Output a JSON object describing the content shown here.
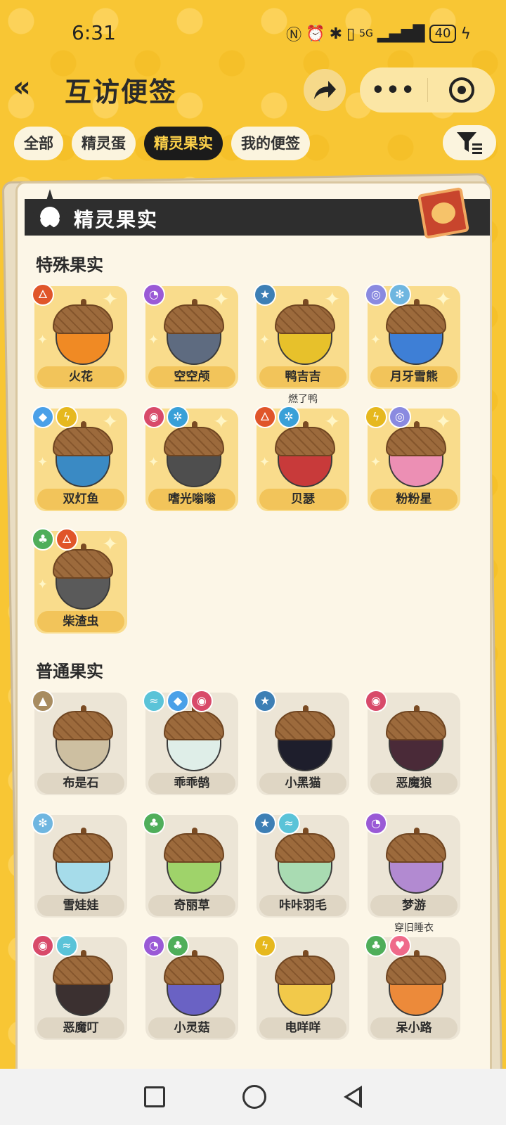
{
  "status": {
    "time": "6:31",
    "network": "5G",
    "battery": "40"
  },
  "header": {
    "title": "互访便签",
    "more": "•••"
  },
  "tabs": [
    "全部",
    "精灵蛋",
    "精灵果实",
    "我的便签"
  ],
  "active_tab_index": 2,
  "banner": {
    "title": "精灵果实"
  },
  "special": {
    "title": "特殊果实",
    "items": [
      {
        "name": "火花",
        "types": [
          "fire"
        ],
        "color": "#f08a24",
        "extra": ""
      },
      {
        "name": "空空颅",
        "types": [
          "ghost"
        ],
        "color": "#5e6b80",
        "extra": ""
      },
      {
        "name": "鸭吉吉",
        "types": [
          "normal"
        ],
        "color": "#e7c12b",
        "extra": "燃了鸭"
      },
      {
        "name": "月牙雪熊",
        "types": [
          "psychic",
          "ice"
        ],
        "color": "#3e7fd6",
        "extra": ""
      },
      {
        "name": "双灯鱼",
        "types": [
          "water",
          "electric"
        ],
        "color": "#3a8ac4",
        "extra": ""
      },
      {
        "name": "嗜光嗡嗡",
        "types": [
          "demon",
          "mech"
        ],
        "color": "#4e4e4e",
        "extra": ""
      },
      {
        "name": "贝瑟",
        "types": [
          "fire",
          "mech"
        ],
        "color": "#c83a3a",
        "extra": ""
      },
      {
        "name": "粉粉星",
        "types": [
          "electric",
          "psychic"
        ],
        "color": "#ec8fb4",
        "extra": ""
      },
      {
        "name": "柴渣虫",
        "types": [
          "grass",
          "fire"
        ],
        "color": "#5a5a5a",
        "extra": ""
      }
    ]
  },
  "common": {
    "title": "普通果实",
    "items": [
      {
        "name": "布是石",
        "types": [
          "ground"
        ],
        "color": "#cdbfa1",
        "extra": ""
      },
      {
        "name": "乖乖鹄",
        "types": [
          "wind",
          "water",
          "demon"
        ],
        "color": "#dfeee8",
        "extra": ""
      },
      {
        "name": "小黑猫",
        "types": [
          "normal"
        ],
        "color": "#1e1e2c",
        "extra": ""
      },
      {
        "name": "恶魔狼",
        "types": [
          "demon"
        ],
        "color": "#4a2a38",
        "extra": ""
      },
      {
        "name": "雪娃娃",
        "types": [
          "ice"
        ],
        "color": "#a6dcea",
        "extra": ""
      },
      {
        "name": "奇丽草",
        "types": [
          "grass"
        ],
        "color": "#9fd36a",
        "extra": ""
      },
      {
        "name": "咔咔羽毛",
        "types": [
          "normal",
          "wind"
        ],
        "color": "#a9dbb2",
        "extra": ""
      },
      {
        "name": "梦游",
        "types": [
          "ghost"
        ],
        "color": "#b28ad1",
        "extra": "穿旧睡衣"
      },
      {
        "name": "恶魔叮",
        "types": [
          "demon",
          "wind"
        ],
        "color": "#3b3030",
        "extra": ""
      },
      {
        "name": "小灵菇",
        "types": [
          "ghost",
          "grass"
        ],
        "color": "#6a62c4",
        "extra": ""
      },
      {
        "name": "电咩咩",
        "types": [
          "electric"
        ],
        "color": "#f2c94a",
        "extra": ""
      },
      {
        "name": "呆小路",
        "types": [
          "grass",
          "cute"
        ],
        "color": "#ec8a3a",
        "extra": ""
      }
    ]
  },
  "type_colors": {
    "fire": "#e0552a",
    "ghost": "#9a5ad6",
    "normal": "#3d7fb5",
    "psychic": "#8a8ae0",
    "ice": "#6fb6e0",
    "water": "#4aa0e8",
    "electric": "#e6b81e",
    "demon": "#d84a6a",
    "mech": "#39a0d8",
    "grass": "#4fae5a",
    "ground": "#a88c60",
    "wind": "#5ac3d8",
    "cute": "#ef6a8a"
  },
  "type_glyphs": {
    "fire": "🜂",
    "ghost": "◔",
    "normal": "★",
    "psychic": "◎",
    "ice": "✻",
    "water": "◆",
    "electric": "ϟ",
    "demon": "◉",
    "mech": "✲",
    "grass": "♣",
    "ground": "▲",
    "wind": "≈",
    "cute": "♥"
  }
}
